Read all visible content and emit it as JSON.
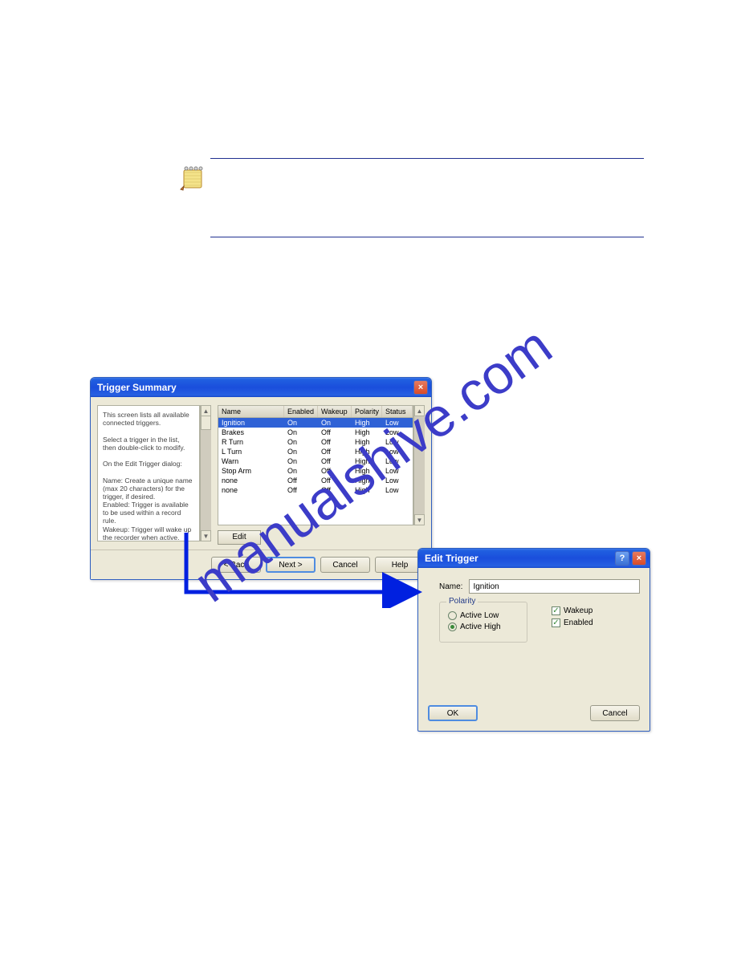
{
  "watermark": "manualshive.com",
  "triggerSummary": {
    "title": "Trigger Summary",
    "helpText": "This screen lists all available connected triggers.\n\nSelect a trigger in the list, then double-click to modify.\n\nOn the Edit Trigger dialog:\n\nName: Create a unique name (max 20 characters) for the trigger, if desired.\nEnabled: Trigger is available to be used within a record rule.\nWakeup: Trigger will wake up the recorder when active.\n\nNOTE: You require at least one wake-up trigger (typically the Ignition).\n\nPolarity: Active Low means the",
    "columns": {
      "name": "Name",
      "enabled": "Enabled",
      "wakeup": "Wakeup",
      "polarity": "Polarity",
      "status": "Status"
    },
    "rows": [
      {
        "name": "Ignition",
        "enabled": "On",
        "wakeup": "On",
        "polarity": "High",
        "status": "Low",
        "selected": true
      },
      {
        "name": "Brakes",
        "enabled": "On",
        "wakeup": "Off",
        "polarity": "High",
        "status": "Low"
      },
      {
        "name": "R Turn",
        "enabled": "On",
        "wakeup": "Off",
        "polarity": "High",
        "status": "Low"
      },
      {
        "name": "L Turn",
        "enabled": "On",
        "wakeup": "Off",
        "polarity": "High",
        "status": "Low"
      },
      {
        "name": "Warn",
        "enabled": "On",
        "wakeup": "Off",
        "polarity": "High",
        "status": "Low"
      },
      {
        "name": "Stop Arm",
        "enabled": "On",
        "wakeup": "Off",
        "polarity": "High",
        "status": "Low"
      },
      {
        "name": "none",
        "enabled": "Off",
        "wakeup": "Off",
        "polarity": "High",
        "status": "Low"
      },
      {
        "name": "none",
        "enabled": "Off",
        "wakeup": "Off",
        "polarity": "High",
        "status": "Low"
      }
    ],
    "edit_label": "Edit",
    "back_label": "< Back",
    "next_label": "Next >",
    "cancel_label": "Cancel",
    "help_label": "Help"
  },
  "editTrigger": {
    "title": "Edit Trigger",
    "name_label": "Name:",
    "name_value": "Ignition",
    "polarity_legend": "Polarity",
    "active_low_label": "Active Low",
    "active_high_label": "Active High",
    "polarity_value": "Active High",
    "wakeup_label": "Wakeup",
    "wakeup_checked": true,
    "enabled_label": "Enabled",
    "enabled_checked": true,
    "ok_label": "OK",
    "cancel_label": "Cancel"
  }
}
